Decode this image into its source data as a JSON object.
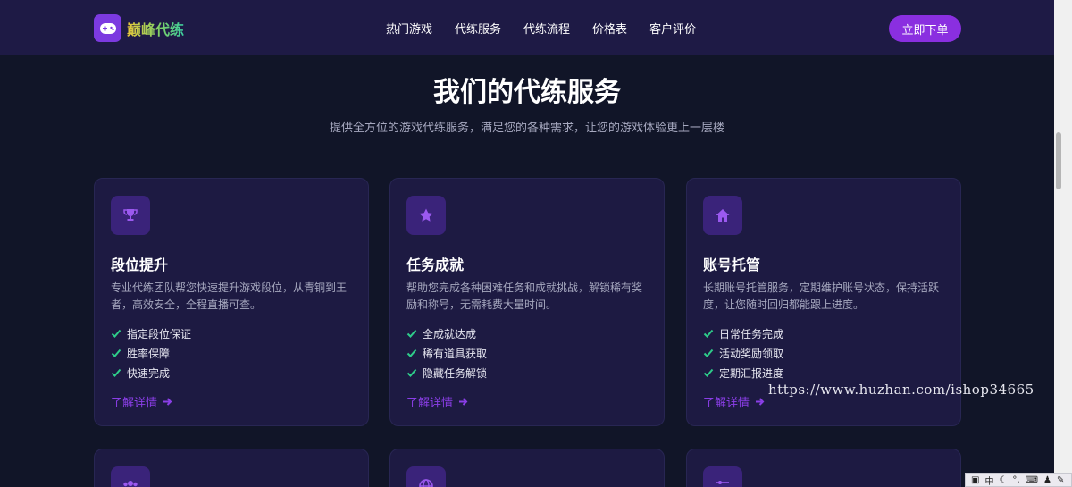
{
  "brand": {
    "name": "巅峰代练",
    "icon": "gamepad-icon"
  },
  "nav": {
    "items": [
      "热门游戏",
      "代练服务",
      "代练流程",
      "价格表",
      "客户评价"
    ]
  },
  "cta": {
    "label": "立即下单"
  },
  "section": {
    "title": "我们的代练服务",
    "subtitle": "提供全方位的游戏代练服务，满足您的各种需求，让您的游戏体验更上一层楼"
  },
  "colors": {
    "accent": "#8a2fe0",
    "check": "#2ecc8a",
    "link": "#8a3ee6",
    "card_bg": "#1d1a42",
    "page_bg": "#111528"
  },
  "cards": [
    {
      "icon": "trophy-icon",
      "title": "段位提升",
      "desc": "专业代练团队帮您快速提升游戏段位，从青铜到王者，高效安全，全程直播可查。",
      "features": [
        "指定段位保证",
        "胜率保障",
        "快速完成"
      ],
      "link": "了解详情"
    },
    {
      "icon": "star-icon",
      "title": "任务成就",
      "desc": "帮助您完成各种困难任务和成就挑战，解锁稀有奖励和称号，无需耗费大量时间。",
      "features": [
        "全成就达成",
        "稀有道具获取",
        "隐藏任务解锁"
      ],
      "link": "了解详情"
    },
    {
      "icon": "home-icon",
      "title": "账号托管",
      "desc": "长期账号托管服务，定期维护账号状态，保持活跃度，让您随时回归都能跟上进度。",
      "features": [
        "日常任务完成",
        "活动奖励领取",
        "定期汇报进度"
      ],
      "link": "了解详情"
    }
  ],
  "next_row_icons": [
    "users-icon",
    "globe-icon",
    "sliders-icon"
  ],
  "watermark": "https://www.huzhan.com/ishop34665",
  "ime": {
    "label": "中"
  }
}
